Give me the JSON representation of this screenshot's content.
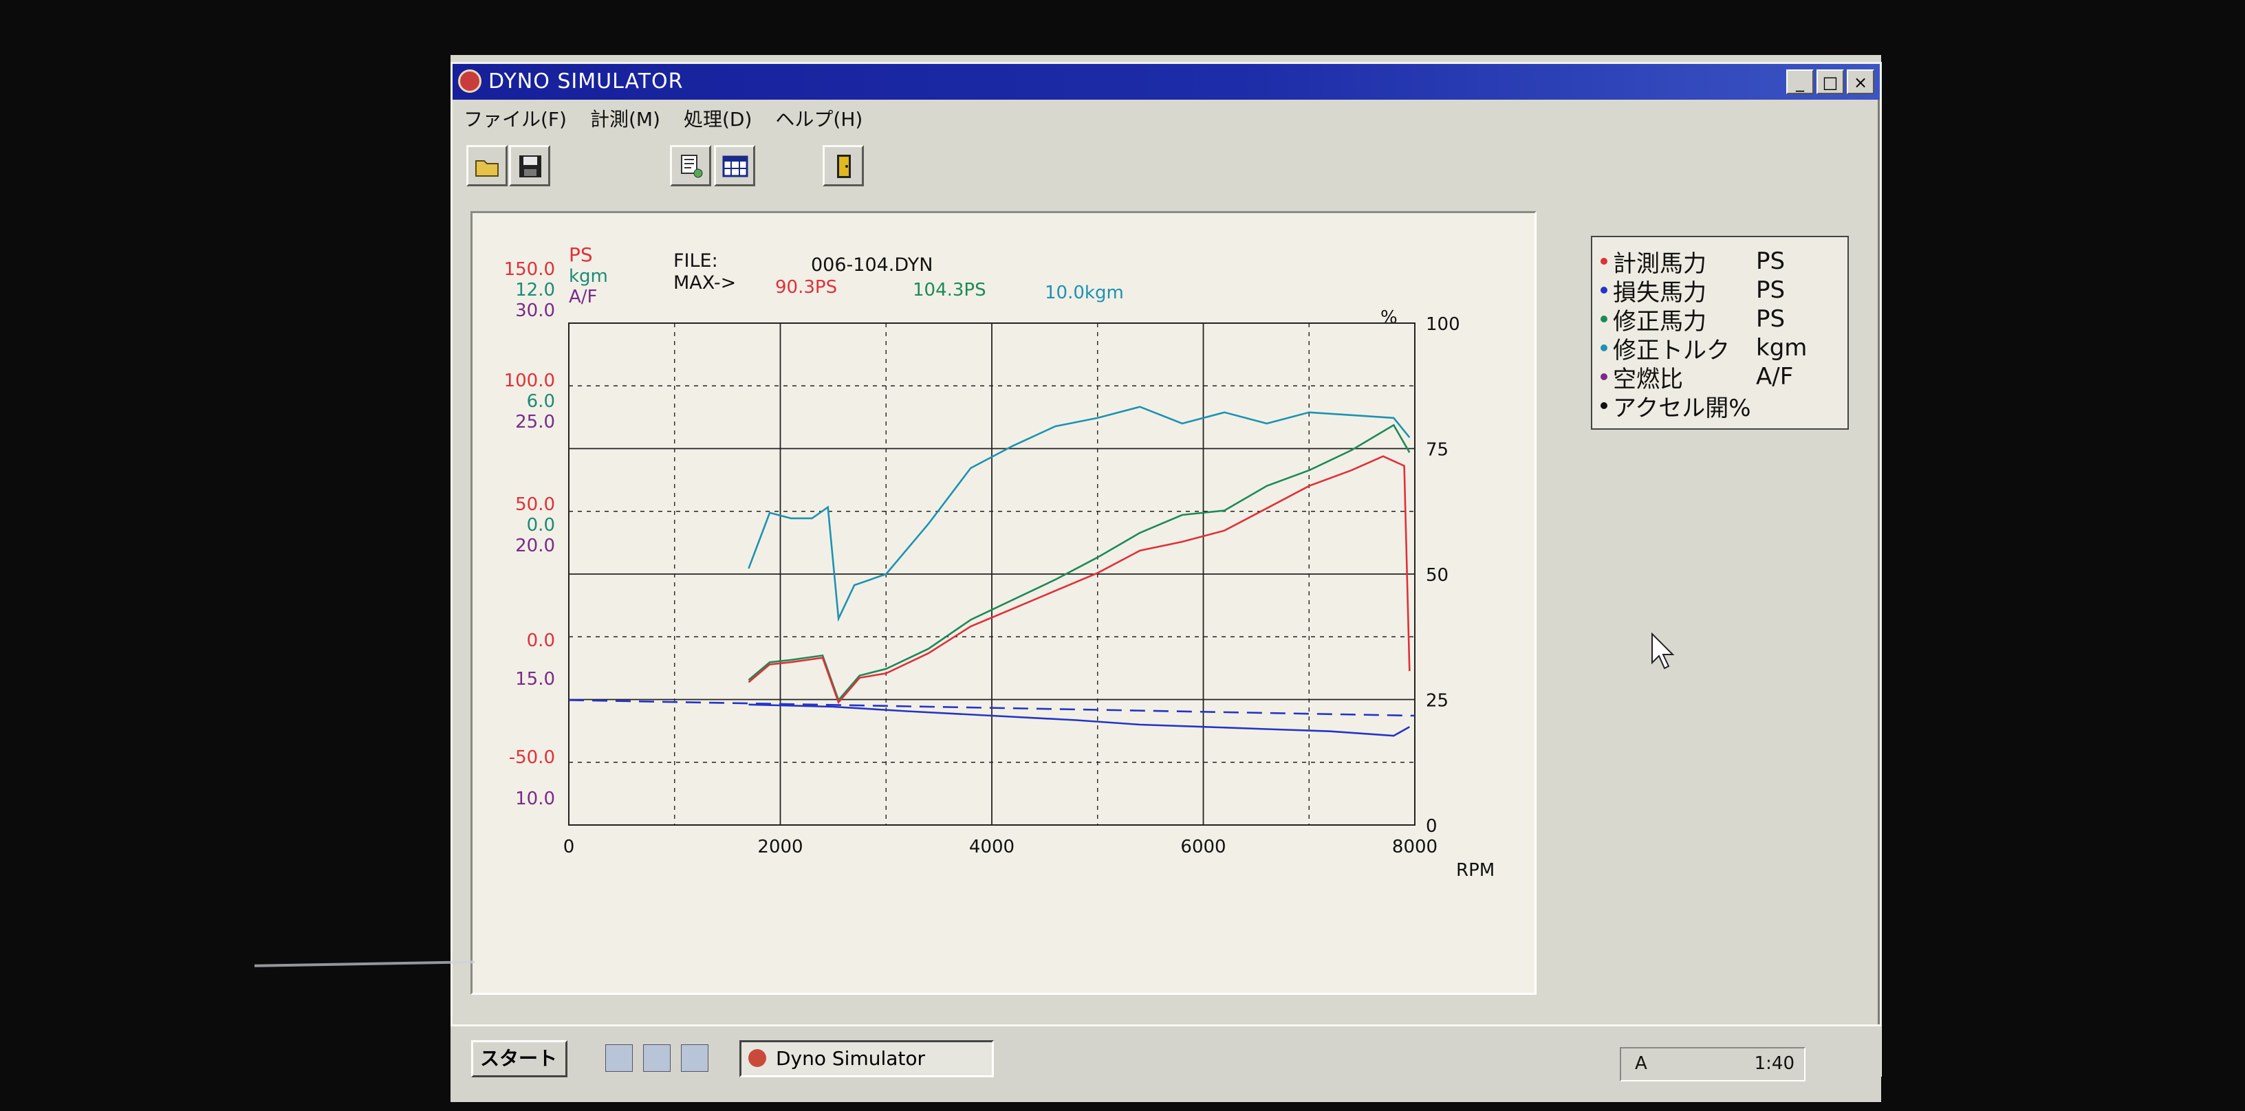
{
  "window": {
    "title": "DYNO SIMULATOR",
    "controls": [
      "_",
      "□",
      "×"
    ]
  },
  "menu": [
    {
      "label": "ファイル(F)"
    },
    {
      "label": "計測(M)"
    },
    {
      "label": "処理(D)"
    },
    {
      "label": "ヘルプ(H)"
    }
  ],
  "toolbar": {
    "icons": [
      "open-folder-icon",
      "save-disk-icon",
      "print-icon",
      "table-icon",
      "exit-door-icon"
    ]
  },
  "graph_header": {
    "file_label": "FILE:",
    "file_name": "006-104.DYN",
    "max_label": "MAX->",
    "max_ps_measured": "90.3PS",
    "max_ps_corrected": "104.3PS",
    "max_torque": "10.0kgm",
    "unit_ps": "PS",
    "unit_kgm": "kgm",
    "unit_af": "A/F",
    "unit_percent": "%",
    "unit_rpm": "RPM"
  },
  "colors": {
    "measured_power": "#e0303a",
    "loss_power": "#2433c9",
    "corrected_power": "#1d8a58",
    "corrected_torque": "#1d92b4",
    "air_fuel": "#7a2a8a",
    "accelerator": "#111111",
    "ps_axis": "#e0303a",
    "kgm_axis": "#1d8a78",
    "af_axis": "#7a2a8a"
  },
  "legend": [
    {
      "label": "計測馬力",
      "unit": "PS",
      "color": "#e0303a"
    },
    {
      "label": "損失馬力",
      "unit": "PS",
      "color": "#2433c9"
    },
    {
      "label": "修正馬力",
      "unit": "PS",
      "color": "#1d8a58"
    },
    {
      "label": "修正トルク",
      "unit": "kgm",
      "color": "#1d92b4"
    },
    {
      "label": "空燃比",
      "unit": "A/F",
      "color": "#7a2a8a"
    },
    {
      "label": "アクセル開%",
      "unit": "",
      "color": "#111111"
    }
  ],
  "chart_data": {
    "type": "line",
    "xlabel": "RPM",
    "xlim": [
      0,
      8000
    ],
    "x_ticks": [
      "0",
      "2000",
      "4000",
      "6000",
      "8000"
    ],
    "ps_ticks": [
      "150.0",
      "100.0",
      "50.0",
      "0.0",
      "-50.0"
    ],
    "kgm_ticks": [
      "12.0",
      "6.0",
      "0.0"
    ],
    "af_ticks": [
      "30.0",
      "25.0",
      "20.0",
      "15.0",
      "10.0"
    ],
    "percent_ticks": [
      "100",
      "75",
      "50",
      "25",
      "0"
    ],
    "ps_range": [
      -75,
      150
    ],
    "torque_range": [
      -6,
      12
    ],
    "percent_range": [
      0,
      100
    ],
    "grid": true,
    "legend_position": "right",
    "series": [
      {
        "name": "修正トルク",
        "axis": "kgm",
        "color": "#1d92b4",
        "points": [
          [
            1700,
            3.2
          ],
          [
            1900,
            5.2
          ],
          [
            2100,
            5.0
          ],
          [
            2300,
            5.0
          ],
          [
            2450,
            5.4
          ],
          [
            2550,
            1.4
          ],
          [
            2700,
            2.6
          ],
          [
            3000,
            3.0
          ],
          [
            3400,
            4.8
          ],
          [
            3800,
            6.8
          ],
          [
            4200,
            7.6
          ],
          [
            4600,
            8.3
          ],
          [
            5000,
            8.6
          ],
          [
            5400,
            9.0
          ],
          [
            5800,
            8.4
          ],
          [
            6200,
            8.8
          ],
          [
            6600,
            8.4
          ],
          [
            7000,
            8.8
          ],
          [
            7400,
            8.7
          ],
          [
            7800,
            8.6
          ],
          [
            7950,
            7.9
          ]
        ]
      },
      {
        "name": "修正馬力",
        "axis": "ps",
        "color": "#1d8a58",
        "points": [
          [
            1700,
            -10
          ],
          [
            1900,
            -2
          ],
          [
            2100,
            -1
          ],
          [
            2400,
            1
          ],
          [
            2550,
            -19
          ],
          [
            2750,
            -8
          ],
          [
            3000,
            -5
          ],
          [
            3400,
            4
          ],
          [
            3800,
            17
          ],
          [
            4200,
            26
          ],
          [
            4600,
            35
          ],
          [
            5000,
            45
          ],
          [
            5400,
            56
          ],
          [
            5800,
            64
          ],
          [
            6200,
            66
          ],
          [
            6600,
            77
          ],
          [
            7000,
            84
          ],
          [
            7400,
            93
          ],
          [
            7800,
            104.3
          ],
          [
            7950,
            92
          ]
        ]
      },
      {
        "name": "計測馬力",
        "axis": "ps",
        "color": "#e0303a",
        "points": [
          [
            1700,
            -11
          ],
          [
            1900,
            -3
          ],
          [
            2100,
            -2
          ],
          [
            2400,
            0
          ],
          [
            2550,
            -20
          ],
          [
            2750,
            -9
          ],
          [
            3000,
            -7
          ],
          [
            3400,
            2
          ],
          [
            3800,
            14
          ],
          [
            4200,
            22
          ],
          [
            4600,
            30
          ],
          [
            5000,
            38
          ],
          [
            5400,
            48
          ],
          [
            5800,
            52
          ],
          [
            6200,
            57
          ],
          [
            6600,
            67
          ],
          [
            7000,
            77
          ],
          [
            7400,
            84
          ],
          [
            7700,
            90.3
          ],
          [
            7900,
            86
          ],
          [
            7950,
            -6
          ]
        ]
      },
      {
        "name": "損失馬力",
        "axis": "ps",
        "color": "#2433c9",
        "points": [
          [
            1700,
            -21
          ],
          [
            2500,
            -22
          ],
          [
            3200,
            -24
          ],
          [
            4000,
            -26
          ],
          [
            4800,
            -28
          ],
          [
            5400,
            -30
          ],
          [
            6000,
            -31
          ],
          [
            6600,
            -32
          ],
          [
            7200,
            -33
          ],
          [
            7800,
            -35
          ],
          [
            7950,
            -31
          ]
        ]
      },
      {
        "name": "損失馬力 (ref)",
        "axis": "ps",
        "color": "#2433c9",
        "dashed": true,
        "points": [
          [
            0,
            -19
          ],
          [
            8000,
            -26
          ]
        ]
      }
    ]
  },
  "taskbar": {
    "start_label": "スタート",
    "task_label": "Dyno Simulator",
    "tray_ime": "A",
    "clock": "1:40"
  }
}
